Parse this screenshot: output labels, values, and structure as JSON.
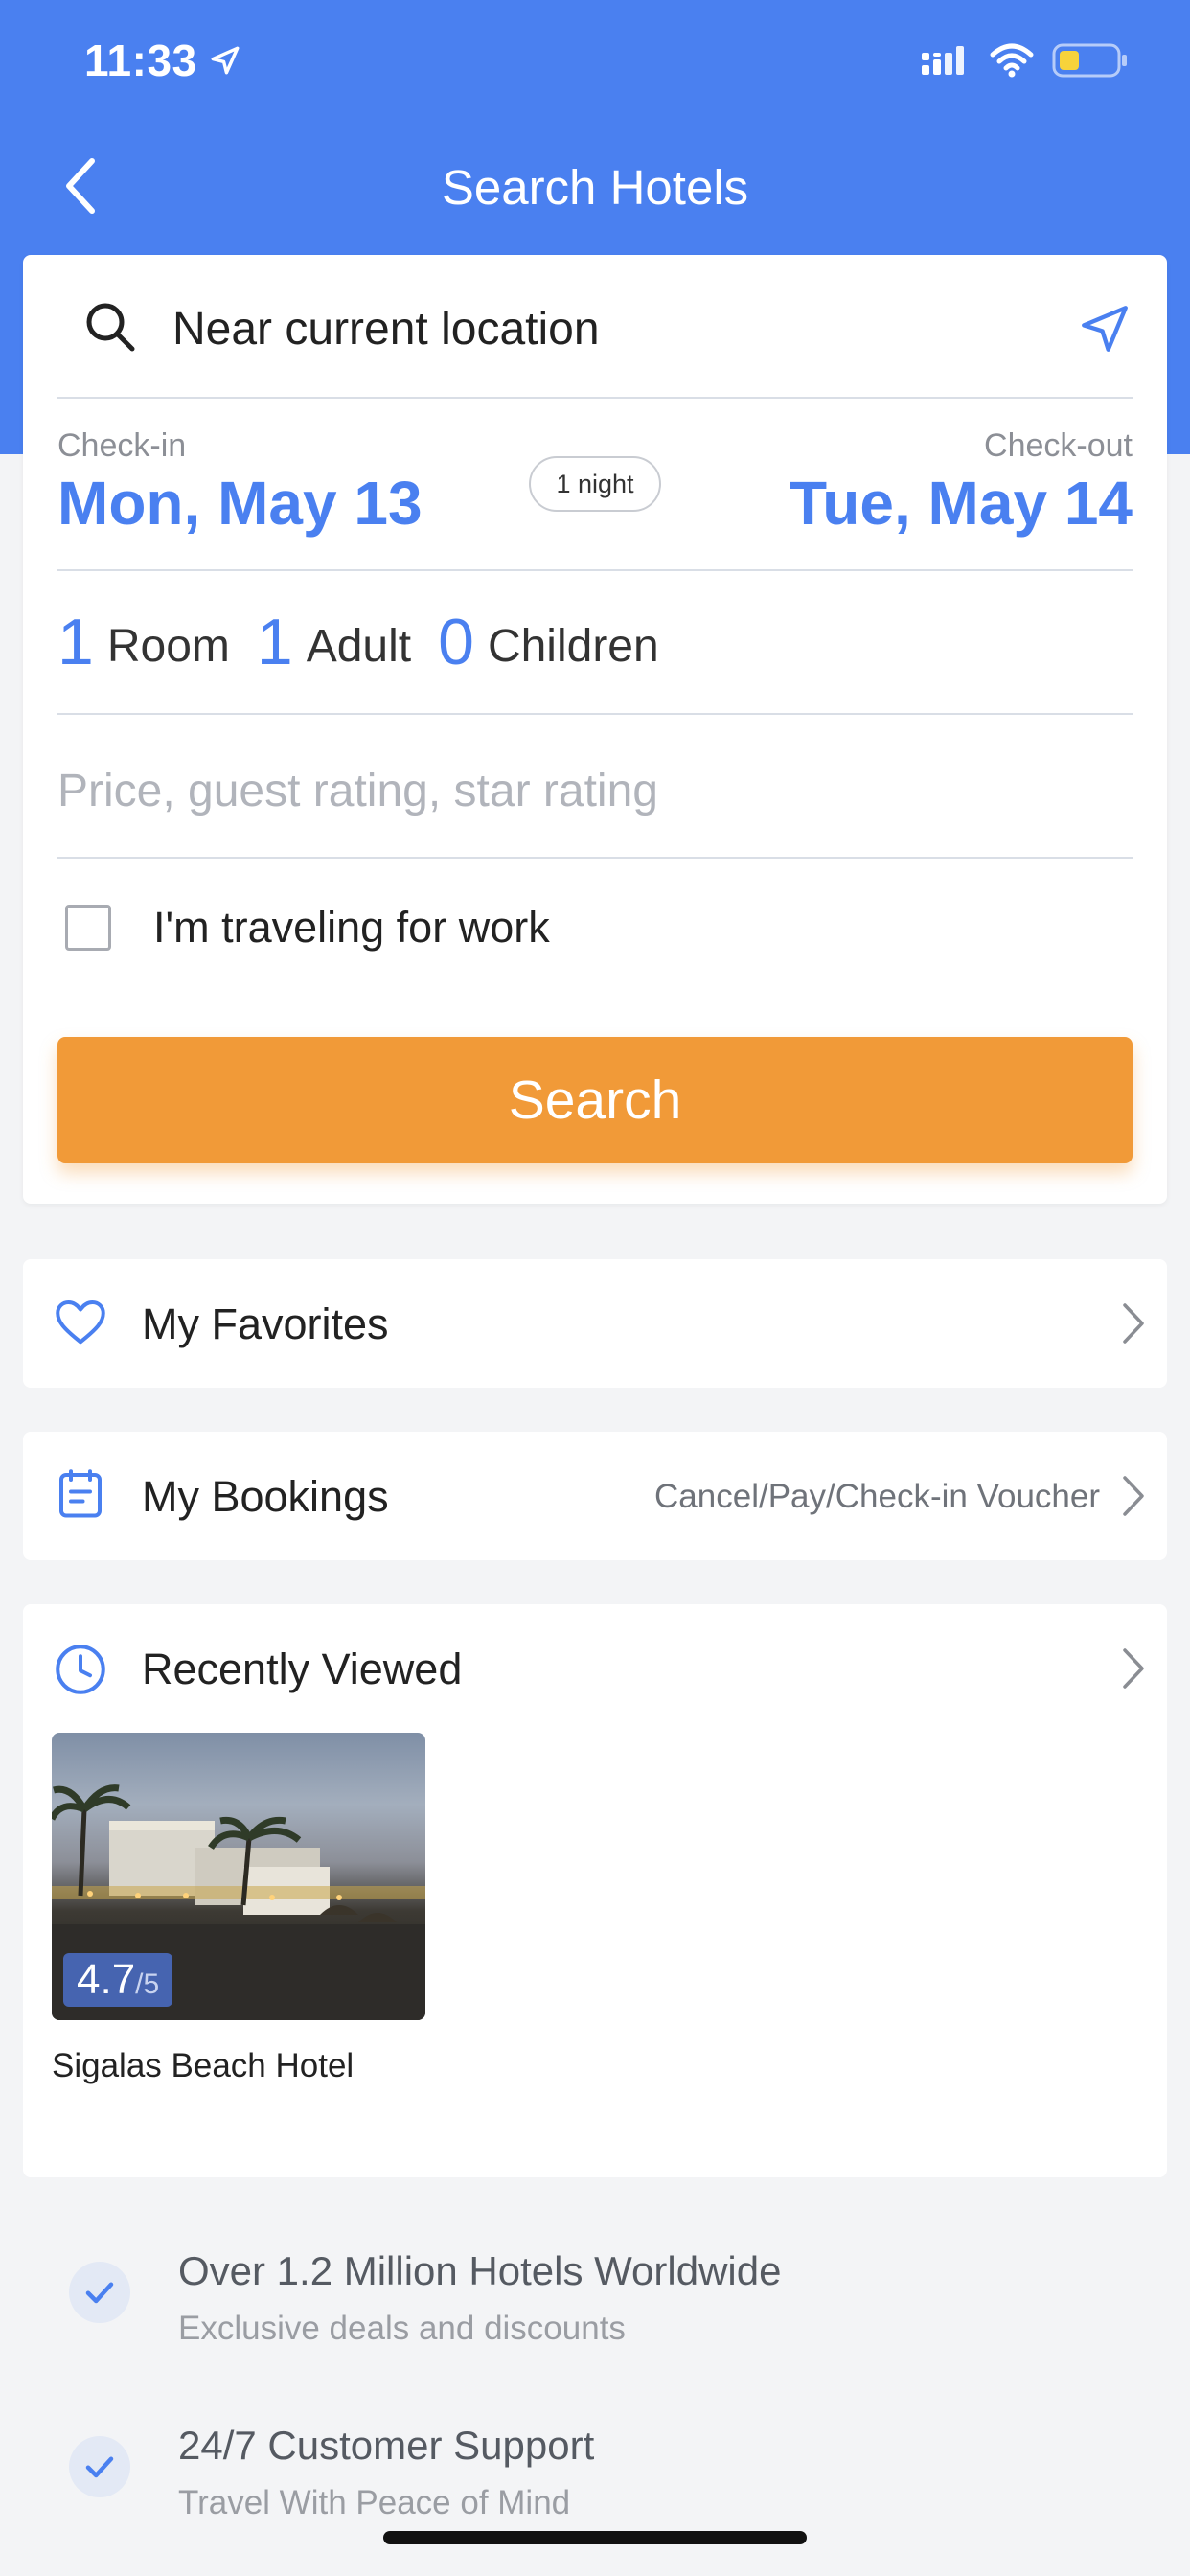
{
  "status_bar": {
    "time": "11:33",
    "location_icon": "location-arrow-icon",
    "signal_icon": "signal-icon",
    "wifi_icon": "wifi-icon",
    "battery_icon": "battery-icon"
  },
  "header": {
    "title": "Search Hotels",
    "back_icon": "chevron-left-icon",
    "background_color": "#4a80f0"
  },
  "search": {
    "location_value": "Near current location",
    "checkin_label": "Check-in",
    "checkin_value": "Mon, May 13",
    "nights": "1 night",
    "checkout_label": "Check-out",
    "checkout_value": "Tue, May 14",
    "rooms_count": "1",
    "rooms_label": "Room",
    "adults_count": "1",
    "adults_label": "Adult",
    "children_count": "0",
    "children_label": "Children",
    "filter_placeholder": "Price, guest rating, star rating",
    "work_label": "I'm traveling for work",
    "work_checked": false,
    "search_button": "Search",
    "button_color": "#f19a38"
  },
  "favorites": {
    "label": "My Favorites",
    "icon": "heart-icon"
  },
  "bookings": {
    "label": "My Bookings",
    "sub": "Cancel/Pay/Check-in Voucher",
    "icon": "calendar-icon"
  },
  "recently_viewed": {
    "label": "Recently Viewed",
    "icon": "clock-icon",
    "hotels": [
      {
        "name": "Sigalas Beach Hotel",
        "rating": "4.7",
        "rating_max": "/5"
      }
    ]
  },
  "features": [
    {
      "title": "Over 1.2 Million Hotels Worldwide",
      "sub": "Exclusive deals and discounts"
    },
    {
      "title": "24/7 Customer Support",
      "sub": "Travel With Peace of Mind"
    }
  ]
}
